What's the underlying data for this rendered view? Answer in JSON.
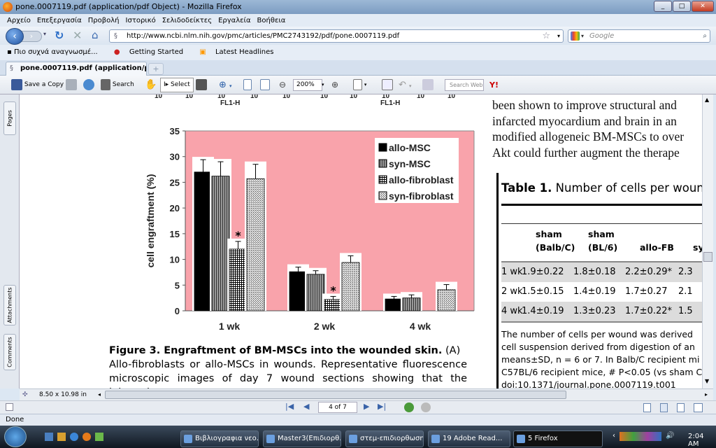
{
  "window": {
    "title": "pone.0007119.pdf (application/pdf Object) - Mozilla Firefox",
    "controls": [
      "_",
      "□",
      "✕"
    ]
  },
  "menu": [
    "Αρχείο",
    "Επεξεργασία",
    "Προβολή",
    "Ιστορικό",
    "Σελιδοδείκτες",
    "Εργαλεία",
    "Βοήθεια"
  ],
  "nav": {
    "url": "http://www.ncbi.nlm.nih.gov/pmc/articles/PMC2743192/pdf/pone.0007119.pdf",
    "search_placeholder": "Google"
  },
  "bookmarks": [
    "Πιο συχνά αναγνωσμέ...",
    "Getting Started",
    "Latest Headlines"
  ],
  "tabs": [
    {
      "label": "pone.0007119.pdf (application/pdf O..."
    }
  ],
  "new_tab": "+",
  "pdf_toolbar": {
    "save": "Save a Copy",
    "search": "Search",
    "select": "Select",
    "zoom": "200%",
    "search_web": "Search Web",
    "yahoo": "Y!"
  },
  "left_tabs": [
    "Pages",
    "Attachments",
    "Comments"
  ],
  "page": {
    "top_axis_label": "FL1-H",
    "top_ticks": "10",
    "figure_caption_bold": "Figure 3. Engraftment of BM-MSCs into the wounded skin.",
    "figure_caption_rest": " (A)",
    "caption_line2": "Allo-fibroblasts or allo-MSCs in wounds. Representative fluorescence",
    "caption_line3": "microscopic images of day 7 wound sections showing that the injected",
    "body_lines": [
      "been shown to improve structural and",
      "infarcted myocardium and brain in an",
      "modified allogeneic BM-MSCs to over",
      "Akt could further augment the therape"
    ],
    "table": {
      "title_bold": "Table 1.",
      "title_rest": " Number of cells per woun",
      "headers": [
        [
          "",
          ""
        ],
        [
          "sham",
          "(Balb/C)"
        ],
        [
          "sham",
          "(BL/6)"
        ],
        [
          "",
          "allo-FB"
        ],
        [
          "",
          "sy"
        ]
      ],
      "rows": [
        [
          "1 wk",
          "1.9±0.22",
          "1.8±0.18",
          "2.2±0.29*",
          "2.3"
        ],
        [
          "2 wk",
          "1.5±0.15",
          "1.4±0.19",
          "1.7±0.27",
          "2.1"
        ],
        [
          "4 wk",
          "1.4±0.19",
          "1.3±0.23",
          "1.7±0.22*",
          "1.5"
        ]
      ],
      "notes": [
        "The number of cells per wound was derived",
        "cell suspension derived from digestion of an",
        "means±SD, n = 6 or 7. In Balb/C recipient mi",
        "C57BL/6 recipient mice, # P<0.05 (vs sham C",
        "doi:10.1371/journal.pone.0007119.t001"
      ]
    }
  },
  "chart_data": {
    "type": "bar",
    "categories": [
      "1 wk",
      "2 wk",
      "4 wk"
    ],
    "ylabel": "cell engraftment (%)",
    "xlabel": "",
    "ylim": [
      0,
      35
    ],
    "yticks": [
      0,
      5,
      10,
      15,
      20,
      25,
      30,
      35
    ],
    "legend_position": "top-right",
    "background": "#f9a3ab",
    "series": [
      {
        "name": "allo-MSC",
        "values": [
          27.0,
          7.6,
          2.3
        ],
        "errors": [
          2.4,
          0.9,
          0.5
        ],
        "color": "#000000",
        "pattern": "solid"
      },
      {
        "name": "syn-MSC",
        "values": [
          26.2,
          7.1,
          2.5
        ],
        "errors": [
          2.8,
          0.7,
          0.6
        ],
        "color": "#777777",
        "pattern": "vertical-lines"
      },
      {
        "name": "allo-fibroblast",
        "values": [
          12.0,
          2.2,
          0
        ],
        "errors": [
          1.5,
          0.6,
          0
        ],
        "color": "#333333",
        "pattern": "grid"
      },
      {
        "name": "syn-fibroblast",
        "values": [
          25.7,
          9.4,
          4.1
        ],
        "errors": [
          2.8,
          1.3,
          1.0
        ],
        "color": "#bbbbbb",
        "pattern": "dots"
      }
    ],
    "annotations": [
      {
        "text": "*",
        "category": "1 wk",
        "series": "allo-fibroblast"
      },
      {
        "text": "*",
        "category": "2 wk",
        "series": "allo-fibroblast"
      }
    ]
  },
  "hscroll": {
    "page_size": "8.50 x 10.98 in"
  },
  "pager": {
    "value": "4 of 7"
  },
  "status": "Done",
  "taskbar": {
    "items": [
      "Βιβλιογραφια νεο...",
      "Master3(Επιδιορθ...",
      "στεμ-επιδιορθωση",
      "19 Adobe Read...",
      "5 Firefox"
    ],
    "clock": "2:04 AM"
  }
}
